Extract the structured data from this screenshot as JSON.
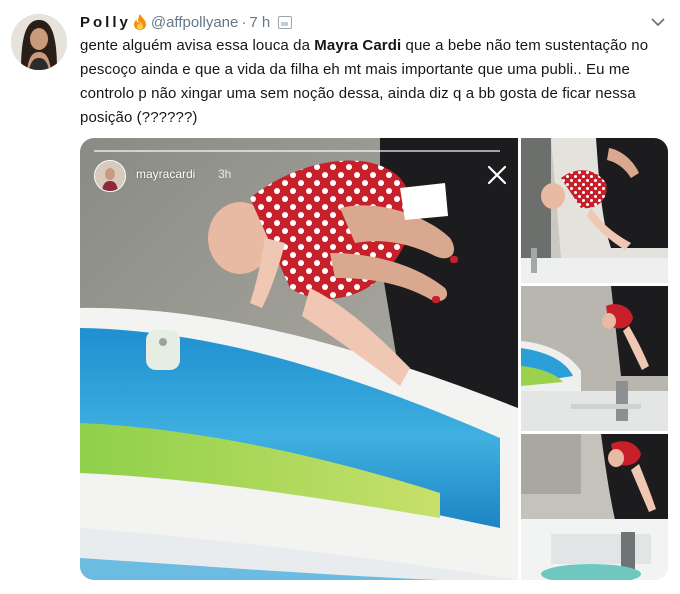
{
  "tweet": {
    "display_name": "Polly",
    "handle": "@affpollyane",
    "dot": "·",
    "time": "7 h",
    "text_before": "gente alguém avisa essa louca da ",
    "text_bold": "Mayra Cardi",
    "text_after": " que a bebe não tem sustentação no pescoço ainda e que a vida da filha eh mt mais importante que uma publi.. Eu me controlo p não xingar uma sem noção dessa, ainda diz q a bb gosta de ficar nessa posição (??????)"
  },
  "story": {
    "username": "mayracardi",
    "time": "3h"
  },
  "icons": {
    "fire": "fire-emoji-icon",
    "media": "media-icon",
    "caret": "chevron-down-icon",
    "close": "close-icon"
  },
  "colors": {
    "text": "#14171a",
    "muted": "#657786",
    "pool_blue": "#2a9fd8",
    "dress_red": "#c8202a"
  }
}
